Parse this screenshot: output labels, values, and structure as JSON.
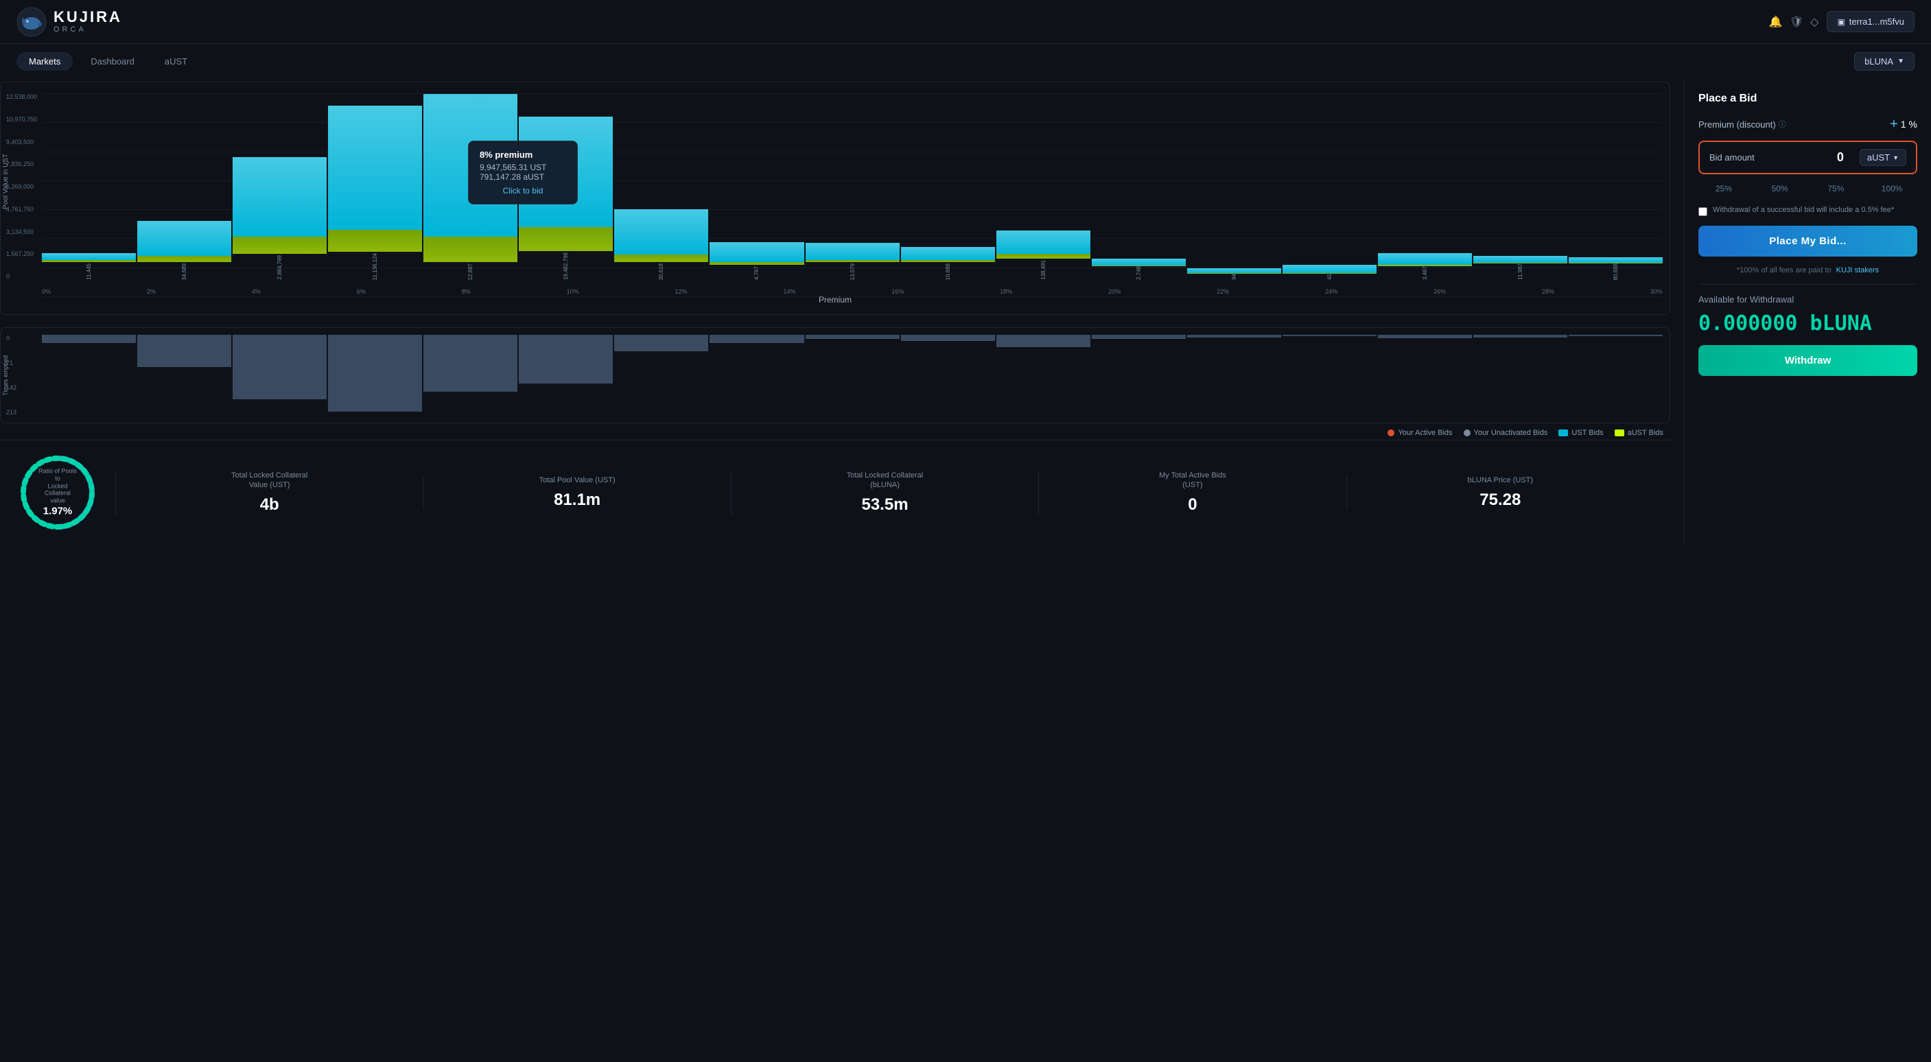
{
  "header": {
    "logo_title": "KUJIRA",
    "logo_subtitle": "ORCA",
    "wallet_label": "terra1...m5fvu"
  },
  "nav": {
    "items": [
      {
        "label": "Markets",
        "active": true
      },
      {
        "label": "Dashboard",
        "active": false
      },
      {
        "label": "aUST",
        "active": false
      }
    ],
    "selected_market": "bLUNA"
  },
  "chart": {
    "y_label": "Pool Value in UST",
    "x_label": "Premium",
    "y_axis": [
      "12,538,000",
      "10,970,750",
      "9,403,500",
      "7,836,250",
      "6,269,000",
      "4,761,750",
      "3,134,500",
      "1,567,250",
      "0"
    ],
    "x_axis": [
      "0%",
      "2%",
      "4%",
      "6%",
      "8%",
      "10%",
      "12%",
      "14%",
      "16%",
      "18%",
      "20%",
      "22%",
      "24%",
      "26%",
      "28%",
      "30%"
    ],
    "tooltip": {
      "premium": "8% premium",
      "ust": "9,947,565.31 UST",
      "aust": "791,147.28 aUST",
      "cta": "Click to bid"
    },
    "bars": [
      {
        "pct": "0%",
        "ust_h": 0.05,
        "aust_h": 0,
        "label": "11,445"
      },
      {
        "pct": "2%",
        "ust_h": 0.22,
        "aust_h": 0.02,
        "label": "34,689"
      },
      {
        "pct": "4%",
        "ust_h": 0.52,
        "aust_h": 0.04,
        "label": "2,884,799"
      },
      {
        "pct": "6%",
        "ust_h": 0.75,
        "aust_h": 0.06,
        "label": "11,136,124"
      },
      {
        "pct": "8%",
        "ust_h": 0.88,
        "aust_h": 0.08,
        "label": "12,887"
      },
      {
        "pct": "10%",
        "ust_h": 0.72,
        "aust_h": 0.12,
        "label": "19,482,798"
      },
      {
        "pct": "12%",
        "ust_h": 0.3,
        "aust_h": 0.05,
        "label": "30,618"
      },
      {
        "pct": "14%",
        "ust_h": 0.14,
        "aust_h": 0.02,
        "label": "4,767"
      },
      {
        "pct": "16%",
        "ust_h": 0.11,
        "aust_h": 0.01,
        "label": "13,079"
      },
      {
        "pct": "18%",
        "ust_h": 0.09,
        "aust_h": 0.01,
        "label": "10,688"
      },
      {
        "pct": "20%",
        "ust_h": 0.17,
        "aust_h": 0.03,
        "label": "138,491"
      },
      {
        "pct": "22%",
        "ust_h": 0.05,
        "aust_h": 0.005,
        "label": "2,748"
      },
      {
        "pct": "24%",
        "ust_h": 0.04,
        "aust_h": 0.004,
        "label": "94"
      },
      {
        "pct": "26%",
        "ust_h": 0.06,
        "aust_h": 0.005,
        "label": "41"
      },
      {
        "pct": "28%",
        "ust_h": 0.08,
        "aust_h": 0.008,
        "label": "3,467"
      },
      {
        "pct": "30%",
        "ust_h": 0.05,
        "aust_h": 0.005,
        "label": "11,987"
      },
      {
        "pct": "30%+",
        "ust_h": 0.04,
        "aust_h": 0.003,
        "label": "80,688"
      }
    ]
  },
  "emptied_chart": {
    "y_label": "Times emptied",
    "y_axis": [
      "0",
      "71",
      "142",
      "213"
    ],
    "bars_heights": [
      0.1,
      0.4,
      0.8,
      0.95,
      0.7,
      0.6,
      0.2,
      0.1,
      0.05,
      0.08,
      0.15,
      0.05,
      0.03,
      0.02,
      0.04,
      0.03,
      0.02
    ]
  },
  "legend": [
    {
      "label": "Your Active Bids",
      "color": "#e05030",
      "type": "dot"
    },
    {
      "label": "Your Unactivated Bids",
      "color": "#7a8aa0",
      "type": "dot"
    },
    {
      "label": "UST Bids",
      "color": "#00b4d8",
      "type": "rect"
    },
    {
      "label": "aUST Bids",
      "color": "#c8ff00",
      "type": "rect"
    }
  ],
  "stats": {
    "ratio_label": "Ratio of Pools to\nLocked\nCollateral value",
    "ratio_value": "1.97%",
    "items": [
      {
        "label": "Total Locked Collateral\nValue (UST)",
        "value": "4b"
      },
      {
        "label": "Total Pool Value (UST)",
        "value": "81.1m"
      },
      {
        "label": "Total Locked Collateral\n(bLUNA)",
        "value": "53.5m"
      },
      {
        "label": "My Total Active Bids\n(UST)",
        "value": "0"
      },
      {
        "label": "bLUNA Price (UST)",
        "value": "75.28"
      }
    ]
  },
  "sidebar": {
    "title": "Place a Bid",
    "premium_label": "Premium (discount)",
    "premium_info_icon": "ⓘ",
    "premium_value": "1",
    "premium_unit": "%",
    "plus_label": "+",
    "bid_amount_label": "Bid amount",
    "bid_amount_value": "0",
    "bid_currency": "aUST",
    "pct_options": [
      "25%",
      "50%",
      "75%",
      "100%"
    ],
    "checkbox_label": "Withdrawal of a successful bid will include a 0.5% fee*",
    "place_bid_label": "Place My Bid...",
    "fee_note": "*100% of all fees are paid to",
    "fee_link_label": "KUJI stakers",
    "withdrawal_title": "Available for Withdrawal",
    "withdrawal_value": "0.000000 bLUNA",
    "withdraw_label": "Withdraw"
  }
}
